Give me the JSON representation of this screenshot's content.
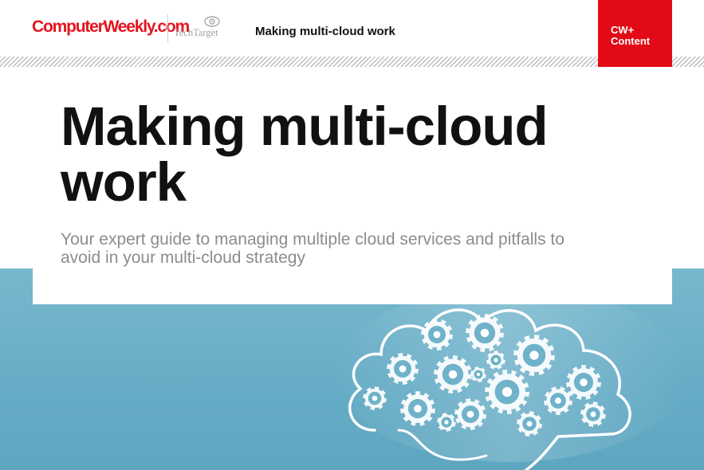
{
  "header": {
    "logo_text": "ComputerWeekly.com",
    "partner_logo_text": "TechTarget",
    "title": "Making multi-cloud  work"
  },
  "badge": {
    "line1": "CW+",
    "line2": "Content"
  },
  "main": {
    "title_line1": "Making multi-cloud",
    "title_line2": "work",
    "subtitle_line1": "Your expert  guide to managing multiple cloud services and pitfalls to",
    "subtitle_line2": "avoid in your multi-cloud strategy"
  },
  "art": {
    "icon": "cloud-of-gears-illustration"
  },
  "colors": {
    "brand_red": "#e20a16",
    "teal": "#6cb0c9",
    "title": "#111111",
    "subtitle": "#8c8c8c"
  }
}
